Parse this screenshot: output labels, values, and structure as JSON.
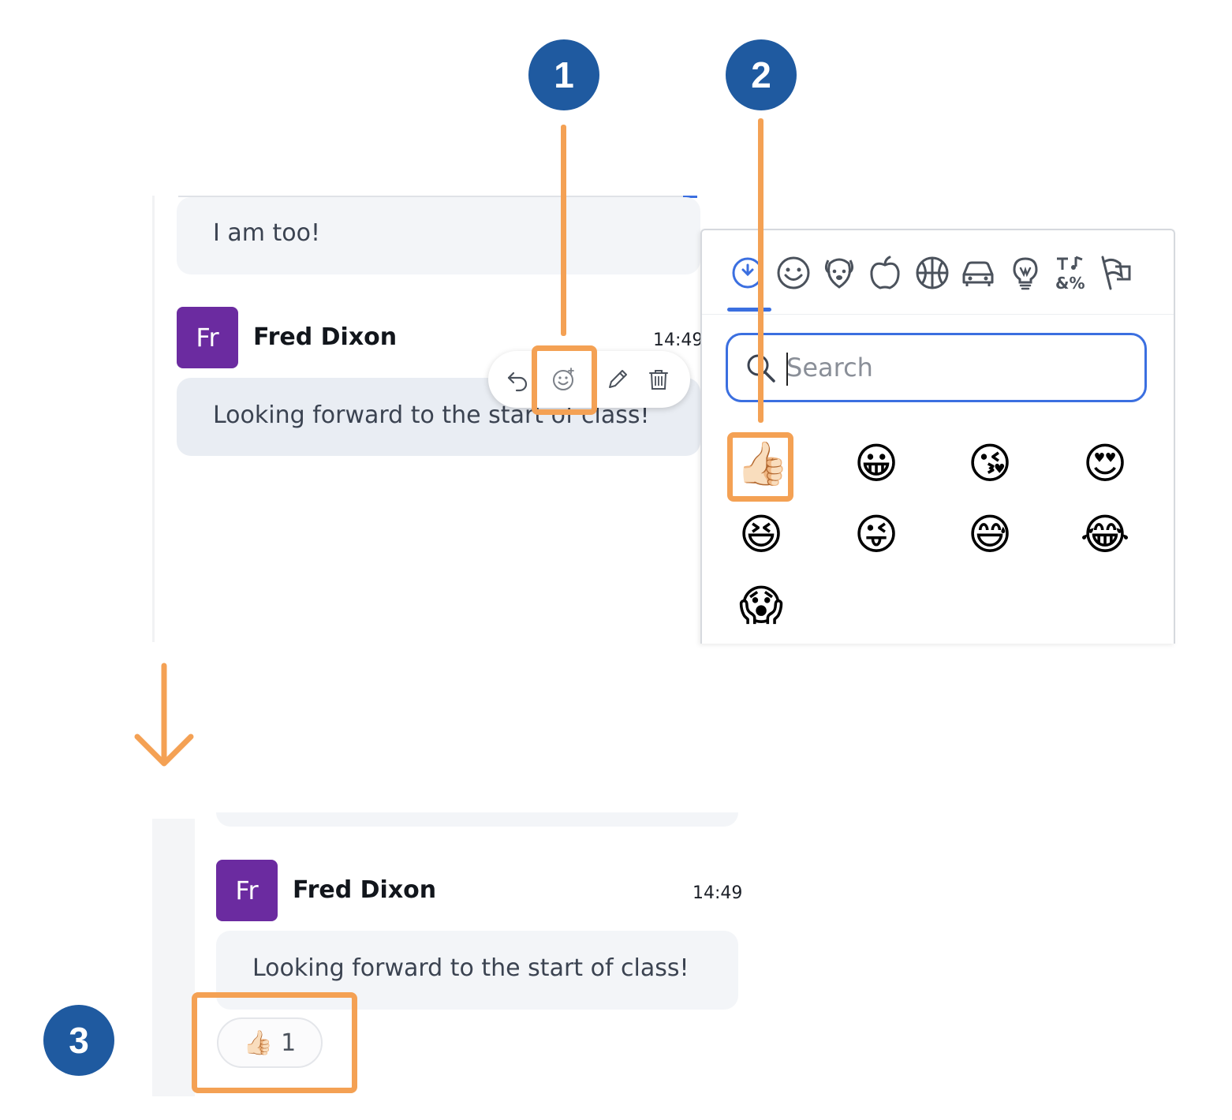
{
  "steps": {
    "one": "1",
    "two": "2",
    "three": "3"
  },
  "top_chat": {
    "prev_message": "I am too!",
    "user": {
      "initials": "Fr",
      "name": "Fred Dixon",
      "time": "14:49"
    },
    "message": "Looking forward to the start of class!",
    "toolbar": {
      "reply_icon": "reply-icon",
      "react_icon": "add-reaction-icon",
      "edit_icon": "pencil-icon",
      "delete_icon": "trash-icon"
    }
  },
  "emoji_picker": {
    "categories": [
      "clock-icon",
      "smiley-icon",
      "dog-icon",
      "apple-icon",
      "basketball-icon",
      "car-icon",
      "lightbulb-icon",
      "symbols-icon",
      "flags-icon"
    ],
    "search_placeholder": "Search",
    "emojis": [
      "👍🏻",
      "😀",
      "😘",
      "😍",
      "😆",
      "😜",
      "😅",
      "😂",
      "😱"
    ]
  },
  "bottom_chat": {
    "user": {
      "initials": "Fr",
      "name": "Fred Dixon",
      "time": "14:49"
    },
    "message": "Looking forward to the start of class!",
    "reaction": {
      "emoji": "👍🏻",
      "count": "1"
    }
  },
  "colors": {
    "badge": "#1f5aa0",
    "highlight": "#f4a154",
    "avatar": "#6b2ba0",
    "accent": "#3b6fe0"
  }
}
